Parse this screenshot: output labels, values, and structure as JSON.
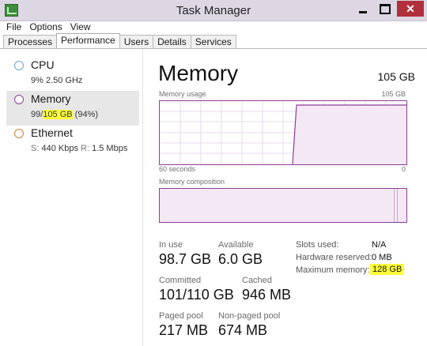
{
  "window": {
    "title": "Task Manager"
  },
  "menu": [
    "File",
    "Options",
    "View"
  ],
  "tabs": [
    "Processes",
    "Performance",
    "Users",
    "Details",
    "Services"
  ],
  "resources": [
    {
      "name": "CPU",
      "detail": "9% 2.50 GHz",
      "color": "#6aa6d8"
    },
    {
      "name": "Memory",
      "detail_used": "99/",
      "detail_total": "105 GB",
      "detail_pct": " (94%)",
      "color": "#8e3d95"
    },
    {
      "name": "Ethernet",
      "detail_s_label": "S:",
      "detail_s": "440 Kbps",
      "detail_r_label": "R:",
      "detail_r": "1.5 Mbps",
      "color": "#d0812f"
    }
  ],
  "main": {
    "title": "Memory",
    "total": "105 GB",
    "usage_label": "Memory usage",
    "usage_max": "105 GB",
    "time_label": "60 seconds",
    "time_end": "0",
    "composition_label": "Memory composition",
    "stats": {
      "in_use_label": "In use",
      "in_use": "98.7 GB",
      "available_label": "Available",
      "available": "6.0 GB",
      "committed_label": "Committed",
      "committed": "101/110 GB",
      "cached_label": "Cached",
      "cached": "946 MB",
      "paged_label": "Paged pool",
      "paged": "217 MB",
      "nonpaged_label": "Non-paged pool",
      "nonpaged": "674 MB"
    },
    "right_stats": {
      "slots_label": "Slots used:",
      "slots": "N/A",
      "hw_label": "Hardware reserved:",
      "hw": "0 MB",
      "max_label": "Maximum memory:",
      "max": "128 GB"
    }
  },
  "colors": {
    "memory_accent": "#8e3d95",
    "highlight": "#ffff3a",
    "close_button": "#b0303b"
  }
}
